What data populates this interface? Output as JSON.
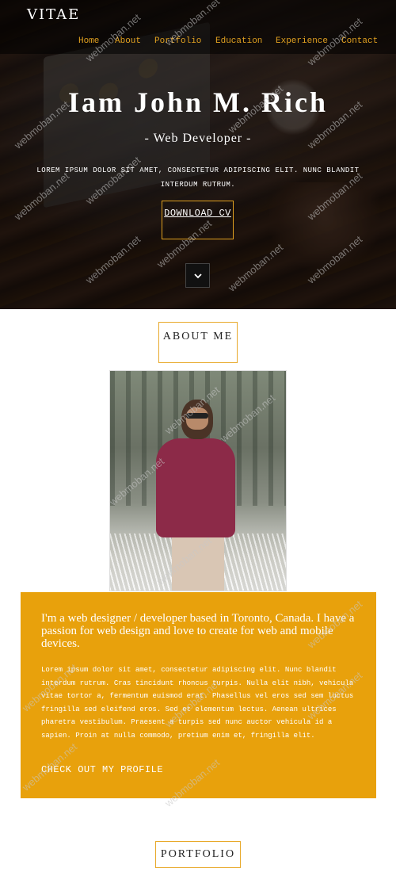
{
  "header": {
    "logo": "VITAE",
    "nav": [
      "Home",
      "About",
      "Portfolio",
      "Education",
      "Experience",
      "Contact"
    ]
  },
  "hero": {
    "headline": "Iam John M. Rich",
    "subtitle": "- Web Developer -",
    "lorem": "LOREM IPSUM DOLOR SIT AMET, CONSECTETUR ADIPISCING ELIT. NUNC BLANDIT INTERDUM RUTRUM.",
    "download_button": "DOWNLOAD CV",
    "scroll_icon": "chevron-down-icon"
  },
  "about": {
    "title": "ABOUT ME",
    "lead": "I'm a web designer / developer based in Toronto, Canada. I have a passion for web design and love to create for web and mobile devices.",
    "body": "Lorem ipsum dolor sit amet, consectetur adipiscing elit. Nunc blandit interdum rutrum. Cras tincidunt rhoncus turpis. Nulla elit nibh, vehicula vitae tortor a, fermentum euismod erat. Phasellus vel eros sed sem luctus fringilla sed eleifend eros. Sed et elementum lectus. Aenean ultrices pharetra vestibulum. Praesent a turpis sed nunc auctor vehicula id a sapien. Proin at nulla commodo, pretium enim et, fringilla elit.",
    "profile_link": "CHECK OUT MY PROFILE"
  },
  "portfolio": {
    "title": "PORTFOLIO"
  },
  "watermark": "webmoban.net",
  "colors": {
    "accent": "#e8a10c",
    "nav": "#e0a020"
  }
}
